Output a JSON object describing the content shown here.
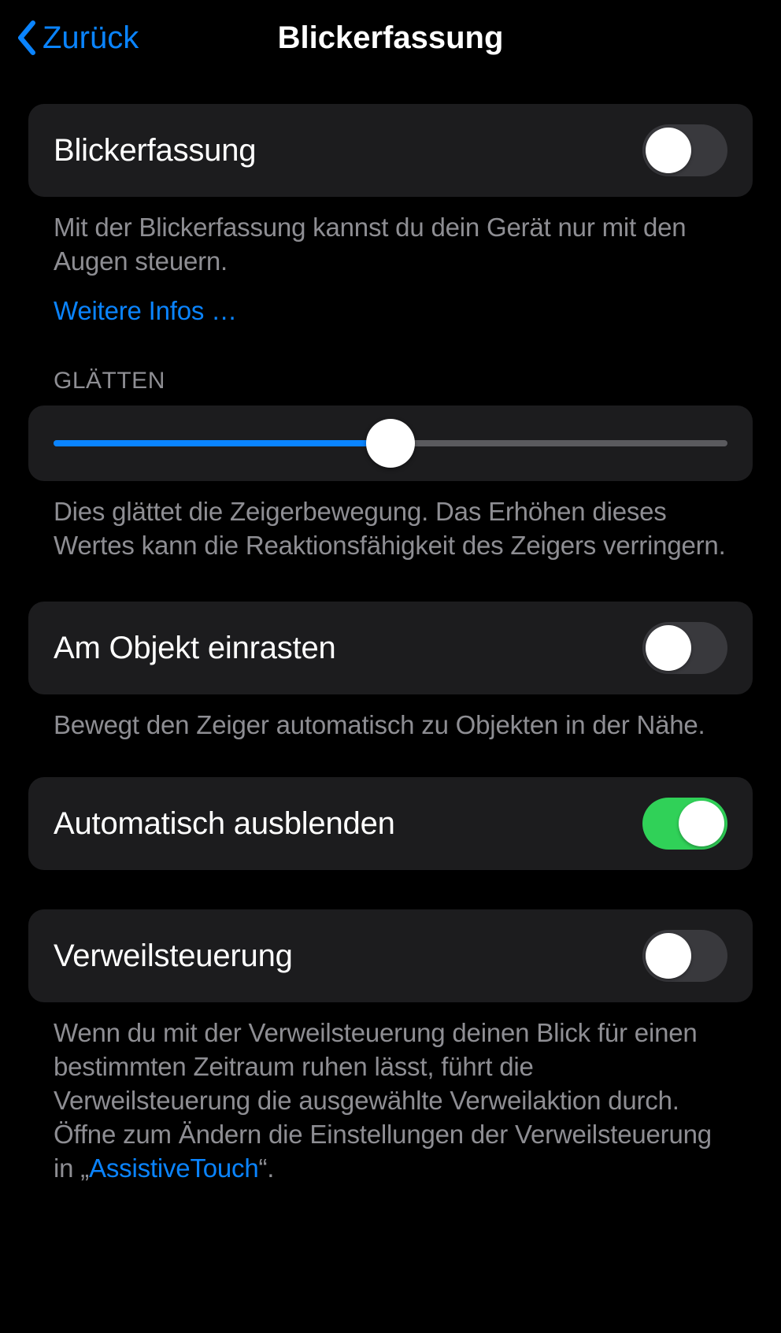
{
  "nav": {
    "back": "Zurück",
    "title": "Blickerfassung"
  },
  "sections": {
    "main": {
      "label": "Blickerfassung",
      "enabled": false,
      "footer": "Mit der Blickerfassung kannst du dein Gerät nur mit den Augen steuern.",
      "link": "Weitere Infos …"
    },
    "smoothing": {
      "header": "GLÄTTEN",
      "value": 50,
      "footer": "Dies glättet die Zeigerbewegung. Das Erhöhen dieses Wertes kann die Reaktionsfähigkeit des Zeigers verringern."
    },
    "snap": {
      "label": "Am Objekt einrasten",
      "enabled": false,
      "footer": "Bewegt den Zeiger automatisch zu Objekten in der Nähe."
    },
    "autohide": {
      "label": "Automatisch ausblenden",
      "enabled": true
    },
    "dwell": {
      "label": "Verweilsteuerung",
      "enabled": false,
      "footer_pre": "Wenn du mit der Verweilsteuerung deinen Blick für einen bestimmten Zeitraum ruhen lässt, führt die Verweilsteuerung die ausgewählte Verweilaktion durch. Öffne zum Ändern die Einstellungen der Verweilsteuerung in „",
      "footer_link": "AssistiveTouch",
      "footer_post": "“."
    }
  }
}
